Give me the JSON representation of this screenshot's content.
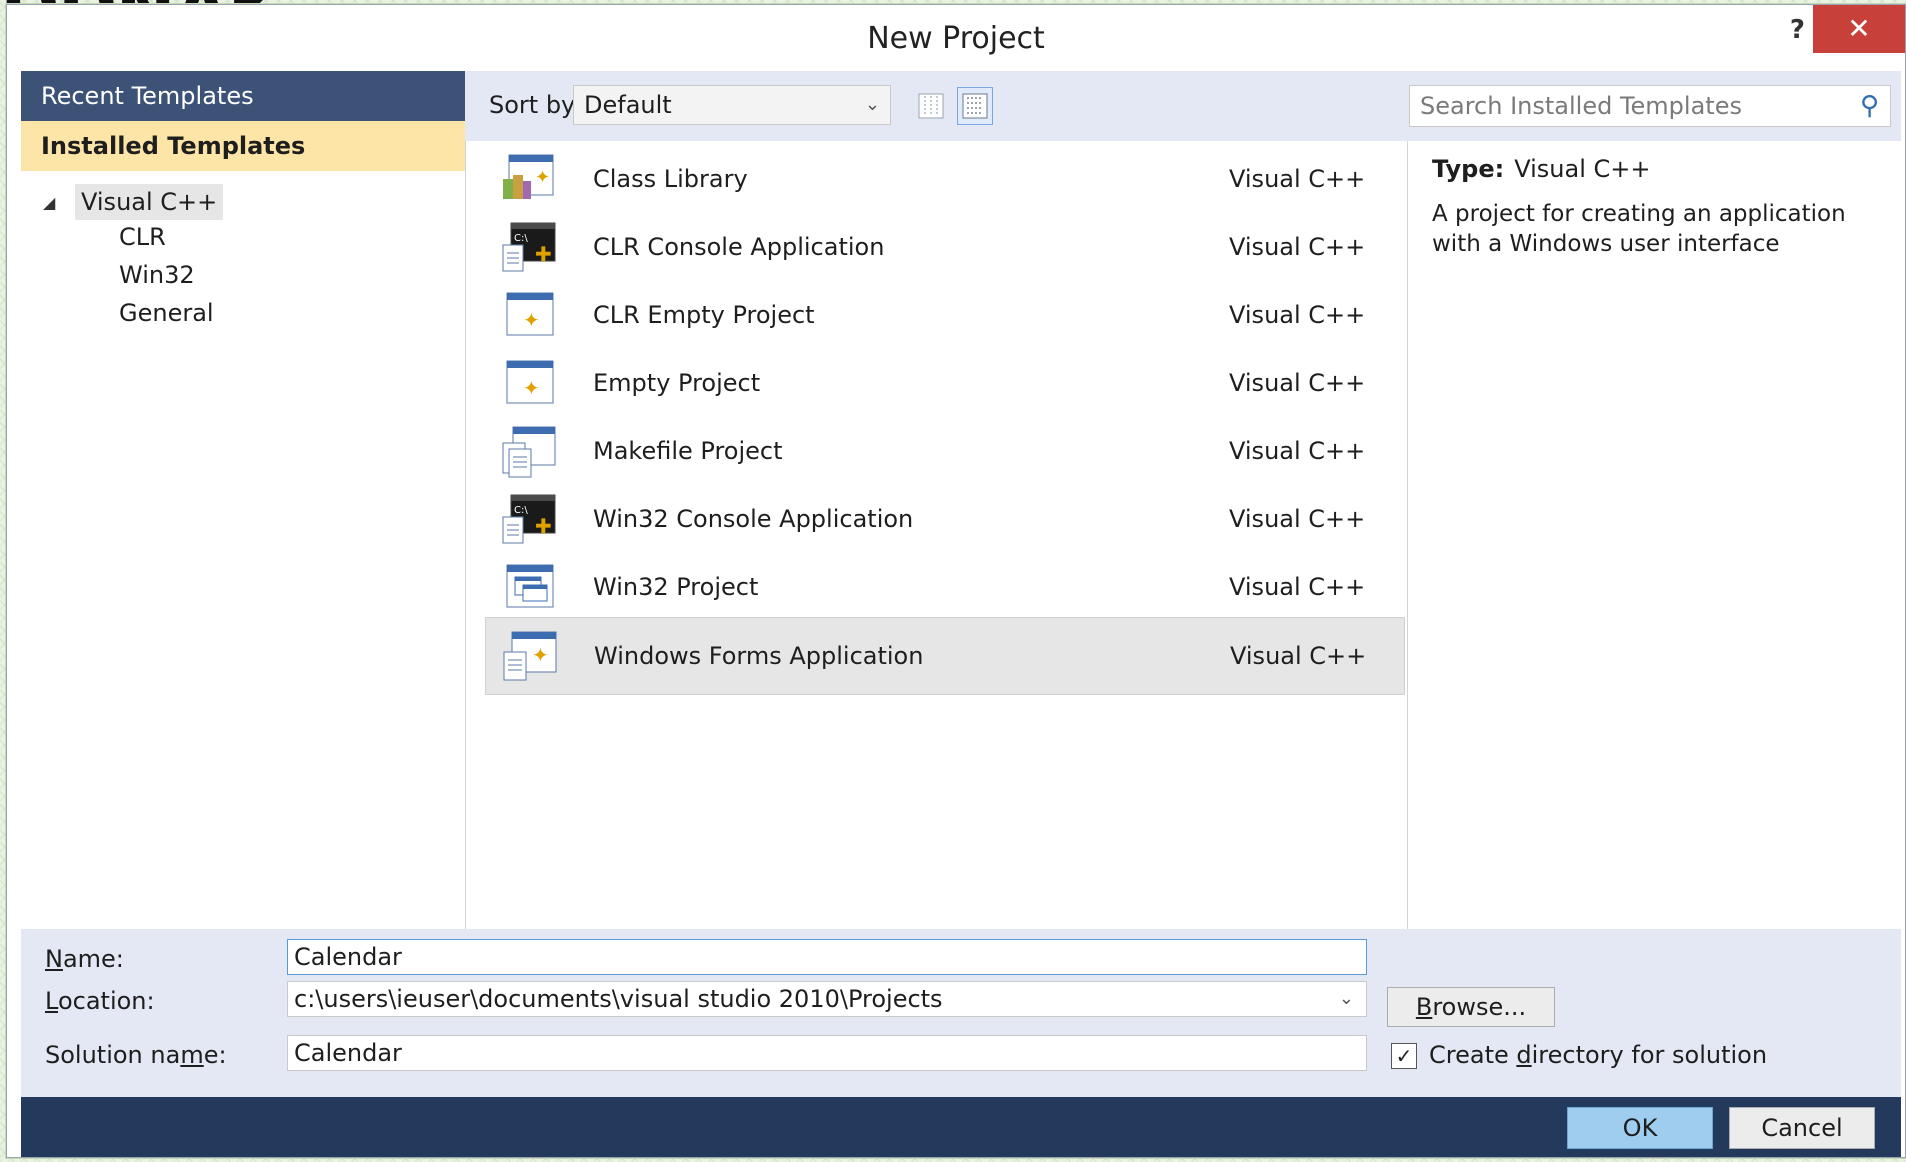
{
  "window": {
    "title": "New Project",
    "help_label": "?",
    "close_label": "✕"
  },
  "left_pane": {
    "recent_label": "Recent Templates",
    "installed_label": "Installed Templates",
    "tree_root": "Visual C++",
    "tree_children": [
      "CLR",
      "Win32",
      "General"
    ]
  },
  "toolbar": {
    "sort_label": "Sort by:",
    "sort_value": "Default",
    "search_placeholder": "Search Installed Templates"
  },
  "templates": [
    {
      "name": "Class Library",
      "language": "Visual C++",
      "icon": "class-library-icon"
    },
    {
      "name": "CLR Console Application",
      "language": "Visual C++",
      "icon": "console-app-icon"
    },
    {
      "name": "CLR Empty Project",
      "language": "Visual C++",
      "icon": "empty-project-icon"
    },
    {
      "name": "Empty Project",
      "language": "Visual C++",
      "icon": "empty-project-icon"
    },
    {
      "name": "Makefile Project",
      "language": "Visual C++",
      "icon": "makefile-project-icon"
    },
    {
      "name": "Win32 Console Application",
      "language": "Visual C++",
      "icon": "console-app-icon"
    },
    {
      "name": "Win32 Project",
      "language": "Visual C++",
      "icon": "win32-project-icon"
    },
    {
      "name": "Windows Forms Application",
      "language": "Visual C++",
      "icon": "forms-app-icon",
      "selected": true
    }
  ],
  "detail": {
    "type_key": "Type:",
    "type_value": "Visual C++",
    "description": "A project for creating an application with a Windows user interface"
  },
  "form": {
    "name_label": "Name:",
    "name_value": "Calendar",
    "location_label": "Location:",
    "location_value": "c:\\users\\ieuser\\documents\\visual studio 2010\\Projects",
    "solution_label": "Solution name:",
    "solution_value": "Calendar",
    "browse_label": "Browse...",
    "create_dir_label": "Create directory for solution",
    "create_dir_checked": true
  },
  "footer": {
    "ok_label": "OK",
    "cancel_label": "Cancel"
  },
  "colors": {
    "nav_header": "#3c5277",
    "installed_highlight": "#fce5a6",
    "footer_bar": "#243a5c",
    "close_red": "#c7413a",
    "ok_blue": "#9fcdf0"
  }
}
